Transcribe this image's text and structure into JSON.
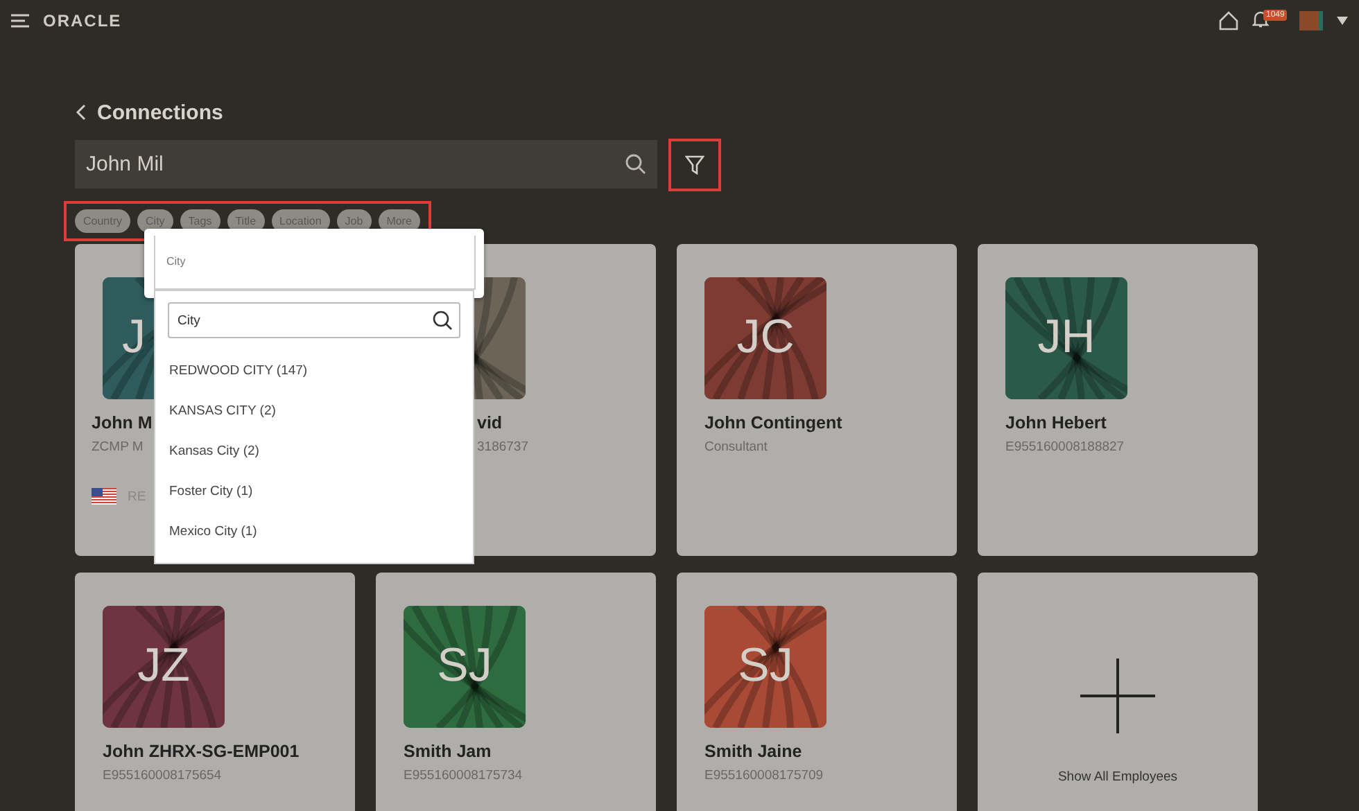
{
  "topbar": {
    "logo": "ORACLE",
    "notification_count": "1049"
  },
  "page": {
    "title": "Connections"
  },
  "search": {
    "value": "John Mil"
  },
  "filter_button": {
    "highlighted": true
  },
  "filter_chips": {
    "highlighted": true,
    "items": [
      {
        "label": "Country"
      },
      {
        "label": "City"
      },
      {
        "label": "Tags"
      },
      {
        "label": "Title"
      },
      {
        "label": "Location"
      },
      {
        "label": "Job"
      },
      {
        "label": "More"
      }
    ]
  },
  "city_dropdown": {
    "label": "City",
    "search_value": "City",
    "options": [
      {
        "label": "REDWOOD CITY (147)"
      },
      {
        "label": "KANSAS CITY (2)"
      },
      {
        "label": "Kansas City (2)"
      },
      {
        "label": "Foster City (1)"
      },
      {
        "label": "Mexico City (1)"
      }
    ]
  },
  "cards": [
    {
      "kind": "person_covered_right",
      "initials": "J",
      "name": "John M",
      "subtitle": "ZCMP M",
      "location": "RE",
      "color": "#2f5b5c"
    },
    {
      "kind": "person_covered_left",
      "name": "vid",
      "subtitle": "3186737",
      "color": "#6b6457"
    },
    {
      "kind": "person",
      "initials": "JC",
      "name": "John Contingent",
      "subtitle": "Consultant",
      "color": "#7d3b33"
    },
    {
      "kind": "person",
      "initials": "JH",
      "name": "John Hebert",
      "subtitle": "E955160008188827",
      "color": "#2c5a4a"
    },
    {
      "kind": "person",
      "initials": "JZ",
      "name": "John ZHRX-SG-EMP001",
      "subtitle": "E955160008175654",
      "color": "#6e3540"
    },
    {
      "kind": "person",
      "initials": "SJ",
      "name": "Smith Jam",
      "subtitle": "E955160008175734",
      "color": "#2e6b3f"
    },
    {
      "kind": "person",
      "initials": "SJ",
      "name": "Smith Jaine",
      "subtitle": "E955160008175709",
      "color": "#a84a35"
    },
    {
      "kind": "show_all",
      "label": "Show All Employees"
    }
  ]
}
